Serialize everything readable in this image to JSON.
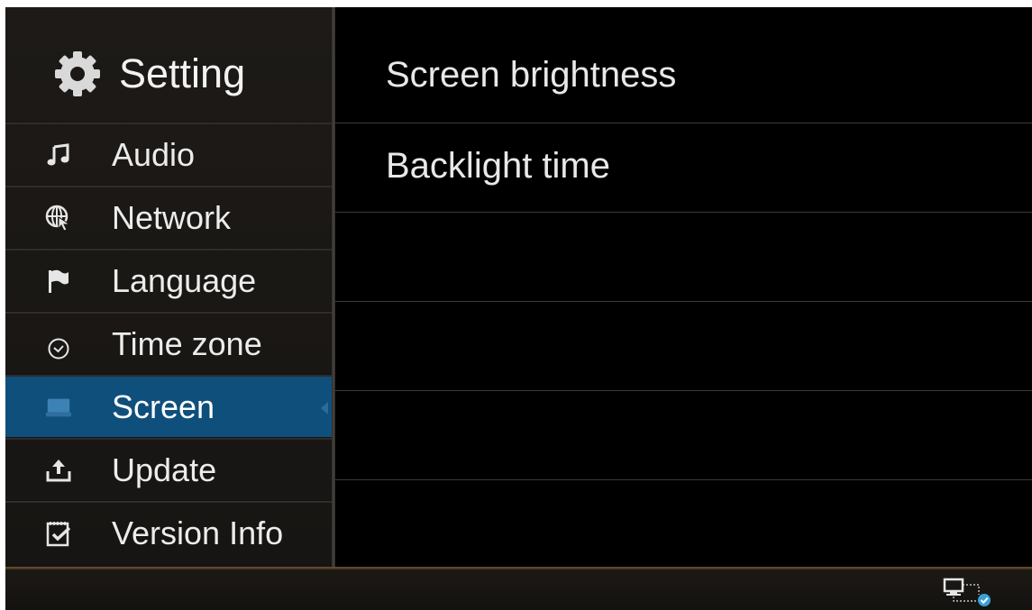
{
  "sidebar": {
    "title": "Setting",
    "title_icon": "gear-icon",
    "items": [
      {
        "label": "Audio",
        "icon": "music-note-icon",
        "active": false
      },
      {
        "label": "Network",
        "icon": "globe-cursor-icon",
        "active": false
      },
      {
        "label": "Language",
        "icon": "flag-icon",
        "active": false
      },
      {
        "label": "Time zone",
        "icon": "clock-icon",
        "active": false
      },
      {
        "label": "Screen",
        "icon": "monitor-icon",
        "active": true
      },
      {
        "label": "Update",
        "icon": "upload-icon",
        "active": false
      },
      {
        "label": "Version Info",
        "icon": "document-check-icon",
        "active": false
      }
    ]
  },
  "content": {
    "rows": [
      {
        "label": "Screen brightness"
      },
      {
        "label": "Backlight time"
      },
      {
        "label": ""
      },
      {
        "label": ""
      },
      {
        "label": ""
      },
      {
        "label": ""
      }
    ]
  },
  "status_bar": {
    "network_status_icon": "network-connected-icon"
  },
  "colors": {
    "active_item_bg": "#0f4f7c",
    "bottom_accent": "#6b5430"
  }
}
